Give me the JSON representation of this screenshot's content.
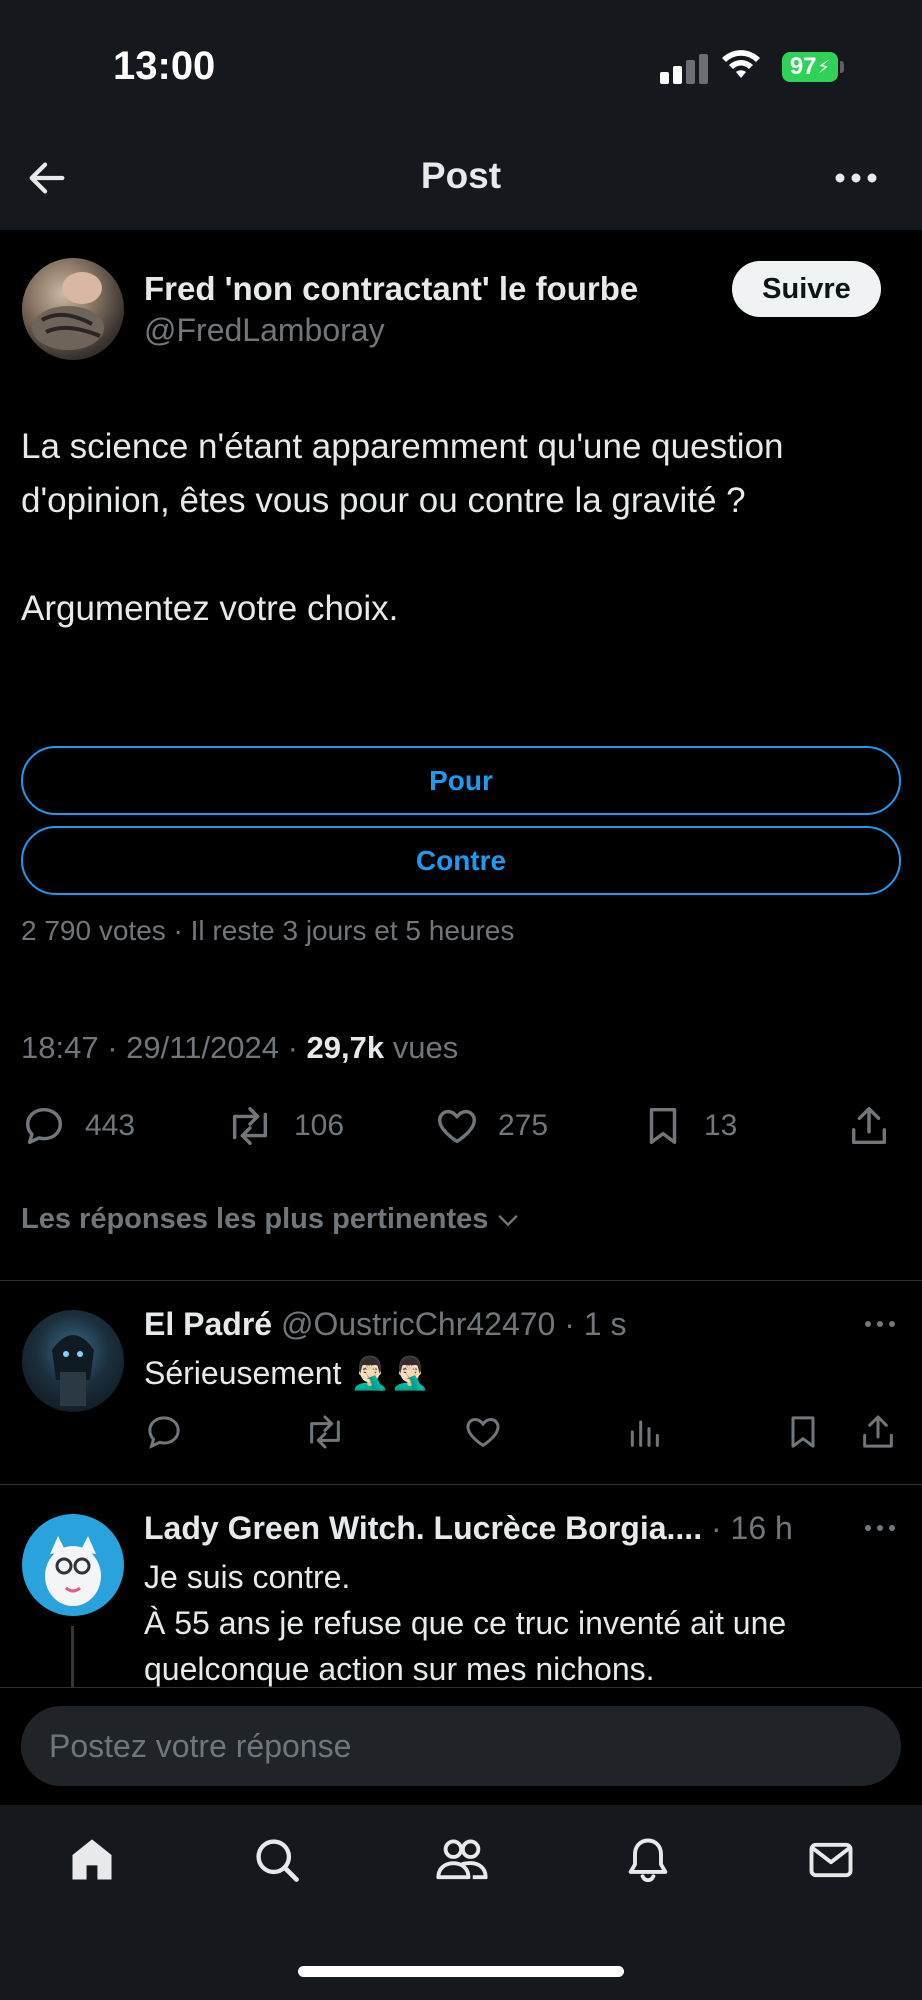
{
  "status_bar": {
    "time": "13:00",
    "battery": "97"
  },
  "header": {
    "title": "Post"
  },
  "author": {
    "name": "Fred 'non contractant' le fourbe",
    "handle": "@FredLamboray",
    "follow_label": "Suivre"
  },
  "post": {
    "paragraphs": [
      "La science n'étant apparemment qu'une question d'opinion, êtes vous pour ou contre la gravité ?",
      "Argumentez votre choix."
    ],
    "poll": {
      "options": [
        "Pour",
        "Contre"
      ],
      "meta": "2 790 votes · Il reste 3 jours et 5 heures"
    },
    "timestamp": "18:47 · 29/11/2024 · ",
    "views_count": "29,7k",
    "views_label": " vues",
    "stats": {
      "replies": "443",
      "reposts": "106",
      "likes": "275",
      "bookmarks": "13"
    }
  },
  "sort_label": "Les réponses les plus pertinentes",
  "replies": [
    {
      "name": "El Padré",
      "meta": " @OustricChr42470 · 1 s",
      "text": "Sérieusement 🤦🏻‍♂️🤦🏻‍♂️"
    },
    {
      "name": "Lady Green Witch. Lucrèce Borgia....",
      "meta": " · 16 h",
      "text_lines": [
        "Je suis contre.",
        "À 55 ans je refuse que ce truc inventé ait une quelconque action sur mes nichons."
      ]
    }
  ],
  "composer": {
    "placeholder": "Postez votre réponse"
  },
  "icons": {
    "back": "arrow-left-icon",
    "more": "more-horizontal-icon",
    "reply": "speech-bubble-icon",
    "repost": "repost-icon",
    "like": "heart-icon",
    "bookmark": "bookmark-icon",
    "share": "share-icon",
    "views": "bar-chart-icon",
    "home": "home-icon",
    "search": "search-icon",
    "communities": "people-icon",
    "notifications": "bell-icon",
    "messages": "envelope-icon"
  },
  "colors": {
    "accent": "#1d9bf0",
    "background": "#000000",
    "secondary_text": "#71767b",
    "battery": "#30d158"
  }
}
